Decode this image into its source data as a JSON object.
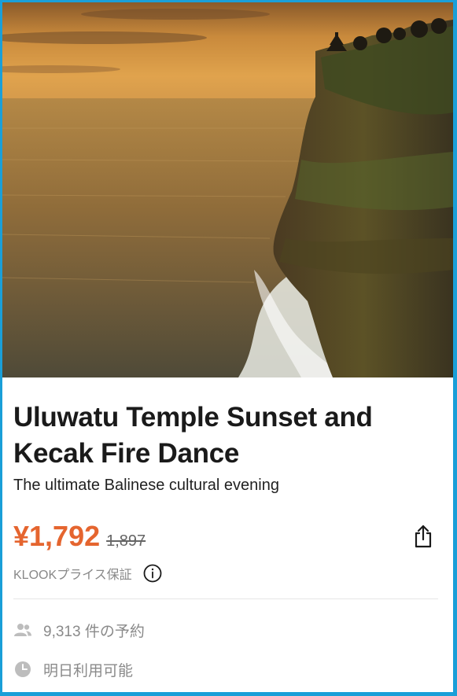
{
  "activity": {
    "title": "Uluwatu Temple Sunset and Kecak Fire Dance",
    "subtitle": "The ultimate Balinese cultural evening"
  },
  "pricing": {
    "price": "¥1,792",
    "original_price": "1,897",
    "guarantee_label": "KLOOKプライス保証"
  },
  "meta": {
    "bookings": "9,313 件の予約",
    "availability": "明日利用可能"
  },
  "icons": {
    "share": "share-icon",
    "info": "info-icon",
    "users": "users-icon",
    "clock": "clock-icon"
  },
  "colors": {
    "price": "#e5652f",
    "frame_border": "#1a9fd8"
  }
}
